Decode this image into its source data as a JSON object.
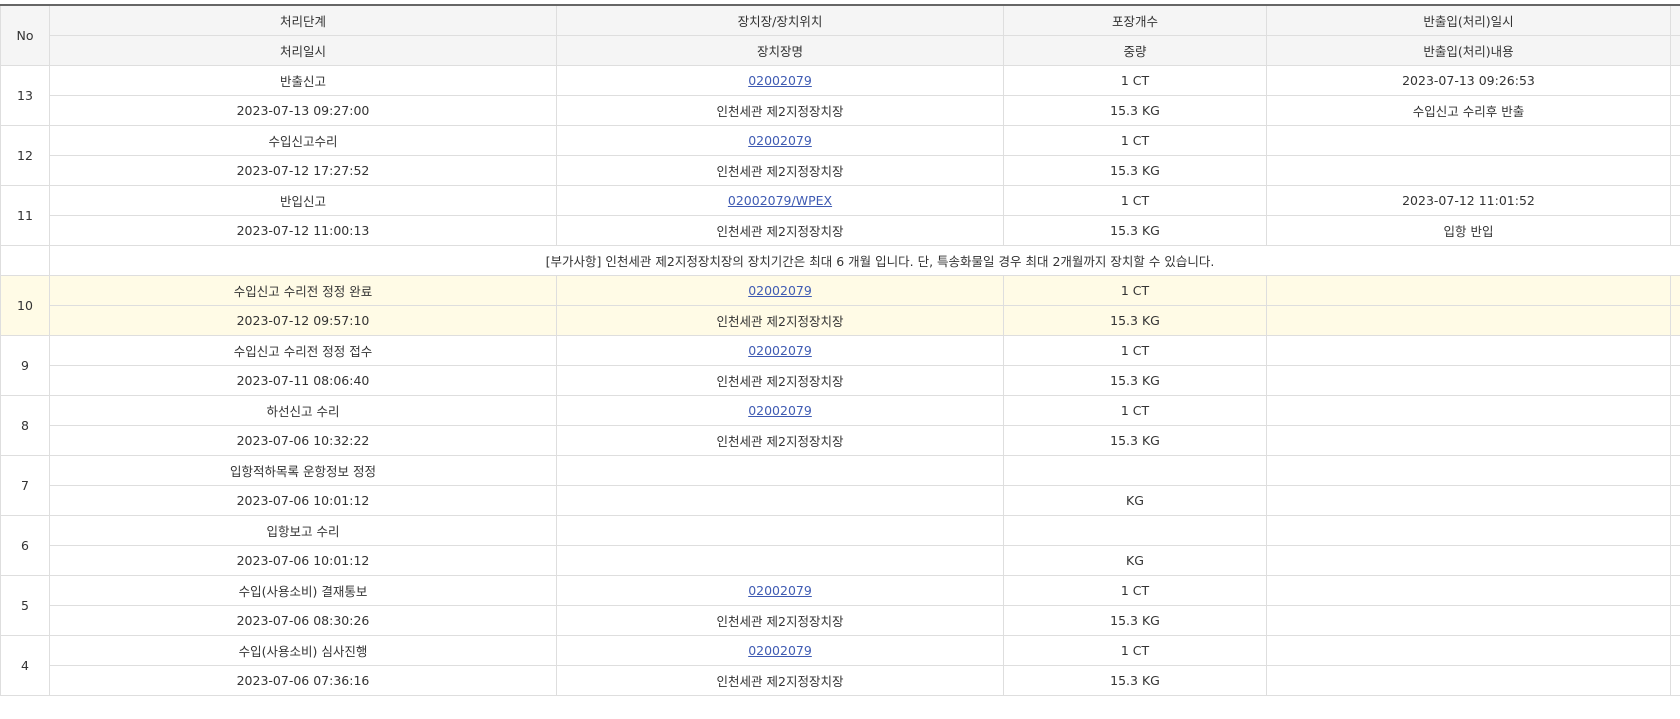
{
  "headers": {
    "row1": {
      "no": "No",
      "step": "처리단계",
      "location": "장치장/장치위치",
      "pkg": "포장개수",
      "io_time": "반출입(처리)일시"
    },
    "row2": {
      "date": "처리일시",
      "name": "장치장명",
      "weight": "중량",
      "io_desc": "반출입(처리)내용"
    }
  },
  "rows": [
    {
      "no": "13",
      "step": "반출신고",
      "date": "2023-07-13 09:27:00",
      "loc": "02002079",
      "name": "인천세관 제2지정장치장",
      "pkg": "1 CT",
      "weight": "15.3 KG",
      "io_time": "2023-07-13 09:26:53",
      "io_desc": "수입신고 수리후 반출"
    },
    {
      "no": "12",
      "step": "수입신고수리",
      "date": "2023-07-12 17:27:52",
      "loc": "02002079",
      "name": "인천세관 제2지정장치장",
      "pkg": "1 CT",
      "weight": "15.3 KG",
      "io_time": "",
      "io_desc": ""
    },
    {
      "no": "11",
      "step": "반입신고",
      "date": "2023-07-12 11:00:13",
      "loc": "02002079/WPEX",
      "name": "인천세관 제2지정장치장",
      "pkg": "1 CT",
      "weight": "15.3 KG",
      "io_time": "2023-07-12 11:01:52",
      "io_desc": "입항 반입"
    },
    {
      "no": "10",
      "step": "수입신고 수리전 정정 완료",
      "date": "2023-07-12 09:57:10",
      "loc": "02002079",
      "name": "인천세관 제2지정장치장",
      "pkg": "1 CT",
      "weight": "15.3 KG",
      "io_time": "",
      "io_desc": ""
    },
    {
      "no": "9",
      "step": "수입신고 수리전 정정 접수",
      "date": "2023-07-11 08:06:40",
      "loc": "02002079",
      "name": "인천세관 제2지정장치장",
      "pkg": "1 CT",
      "weight": "15.3 KG",
      "io_time": "",
      "io_desc": ""
    },
    {
      "no": "8",
      "step": "하선신고 수리",
      "date": "2023-07-06 10:32:22",
      "loc": "02002079",
      "name": "인천세관 제2지정장치장",
      "pkg": "1 CT",
      "weight": "15.3 KG",
      "io_time": "",
      "io_desc": ""
    },
    {
      "no": "7",
      "step": "입항적하목록 운항정보 정정",
      "date": "2023-07-06 10:01:12",
      "loc": "",
      "name": "",
      "pkg": "",
      "weight": "KG",
      "io_time": "",
      "io_desc": ""
    },
    {
      "no": "6",
      "step": "입항보고 수리",
      "date": "2023-07-06 10:01:12",
      "loc": "",
      "name": "",
      "pkg": "",
      "weight": "KG",
      "io_time": "",
      "io_desc": ""
    },
    {
      "no": "5",
      "step": "수입(사용소비) 결재통보",
      "date": "2023-07-06 08:30:26",
      "loc": "02002079",
      "name": "인천세관 제2지정장치장",
      "pkg": "1 CT",
      "weight": "15.3 KG",
      "io_time": "",
      "io_desc": ""
    },
    {
      "no": "4",
      "step": "수입(사용소비) 심사진행",
      "date": "2023-07-06 07:36:16",
      "loc": "02002079",
      "name": "인천세관 제2지정장치장",
      "pkg": "1 CT",
      "weight": "15.3 KG",
      "io_time": "",
      "io_desc": ""
    }
  ],
  "note_row": {
    "after_no": "11",
    "text": "[부가사항] 인천세관 제2지정장치장의 장치기간은 최대 6 개월 입니다. 단, 특송화물일 경우 최대 2개월까지 장치할 수 있습니다."
  },
  "highlight_no": "10",
  "colors": {
    "link": "#3f5bb3",
    "highlight_bg": "#fffbe6",
    "header_bg": "#f5f5f5",
    "border": "#dedede"
  }
}
